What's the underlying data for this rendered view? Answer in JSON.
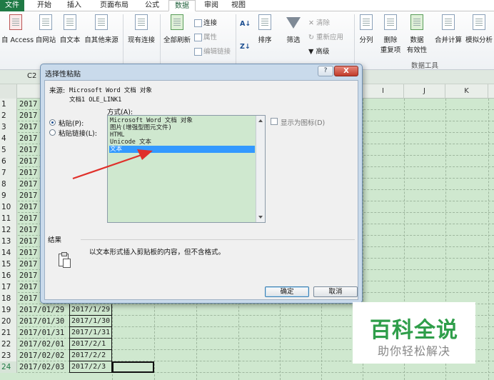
{
  "ribbon": {
    "tabs": [
      {
        "label": "文件",
        "state": "file"
      },
      {
        "label": "开始",
        "state": ""
      },
      {
        "label": "插入",
        "state": ""
      },
      {
        "label": "页面布局",
        "state": ""
      },
      {
        "label": "公式",
        "state": ""
      },
      {
        "label": "数据",
        "state": "active"
      },
      {
        "label": "审阅",
        "state": ""
      },
      {
        "label": "视图",
        "state": ""
      }
    ],
    "buttons": {
      "from_access": "自 Access",
      "from_web": "自网站",
      "from_text": "自文本",
      "from_other": "自其他来源",
      "existing_conn": "现有连接",
      "refresh_all": "全部刷新",
      "connections": "连接",
      "properties": "属性",
      "edit_links": "编辑链接",
      "sort": "排序",
      "filter": "筛选",
      "clear": "清除",
      "reapply": "重新应用",
      "advanced": "高级",
      "text_to_columns": "分列",
      "remove_dup_line1": "删除",
      "remove_dup_line2": "重复项",
      "validation_line1": "数据",
      "validation_line2": "有效性",
      "consolidate": "合并计算",
      "what_if": "模拟分析"
    },
    "groups": {
      "data_tools": "数据工具"
    }
  },
  "namebox": {
    "value": "C2"
  },
  "columns": {
    "right": [
      "I",
      "J",
      "K"
    ]
  },
  "rows": [
    {
      "n": "1",
      "a": "2017",
      "b": ""
    },
    {
      "n": "2",
      "a": "2017",
      "b": ""
    },
    {
      "n": "3",
      "a": "2017",
      "b": ""
    },
    {
      "n": "4",
      "a": "2017",
      "b": ""
    },
    {
      "n": "5",
      "a": "2017",
      "b": ""
    },
    {
      "n": "6",
      "a": "2017",
      "b": ""
    },
    {
      "n": "7",
      "a": "2017",
      "b": ""
    },
    {
      "n": "8",
      "a": "2017",
      "b": ""
    },
    {
      "n": "9",
      "a": "2017",
      "b": ""
    },
    {
      "n": "10",
      "a": "2017",
      "b": ""
    },
    {
      "n": "11",
      "a": "2017",
      "b": ""
    },
    {
      "n": "12",
      "a": "2017",
      "b": ""
    },
    {
      "n": "13",
      "a": "2017",
      "b": ""
    },
    {
      "n": "14",
      "a": "2017",
      "b": ""
    },
    {
      "n": "15",
      "a": "2017",
      "b": ""
    },
    {
      "n": "16",
      "a": "2017",
      "b": ""
    },
    {
      "n": "17",
      "a": "2017",
      "b": ""
    },
    {
      "n": "18",
      "a": "2017",
      "b": ""
    },
    {
      "n": "19",
      "a": "2017/01/29",
      "b": "2017/1/29"
    },
    {
      "n": "20",
      "a": "2017/01/30",
      "b": "2017/1/30"
    },
    {
      "n": "21",
      "a": "2017/01/31",
      "b": "2017/1/31"
    },
    {
      "n": "22",
      "a": "2017/02/01",
      "b": "2017/2/1"
    },
    {
      "n": "23",
      "a": "2017/02/02",
      "b": "2017/2/2"
    },
    {
      "n": "24",
      "a": "2017/02/03",
      "b": "2017/2/3"
    }
  ],
  "dialog": {
    "title": "选择性粘贴",
    "help": "?",
    "close": "X",
    "source_label": "来源:",
    "source_line1": "Microsoft Word 文档 对象",
    "source_line2": "文档1 OLE_LINK1",
    "format_label": "方式(A):",
    "paste_label": "粘贴(P):",
    "paste_link_label": "粘贴链接(L):",
    "formats": [
      "Microsoft Word 文档 对象",
      "图片(增强型图元文件)",
      "HTML",
      "Unicode 文本",
      "文本"
    ],
    "selected_format": 4,
    "show_as_icon": "显示为图标(D)",
    "result_label": "结果",
    "result_text": "以文本形式插入剪贴板的内容，但不含格式。",
    "ok": "确定",
    "cancel": "取消"
  },
  "watermark": {
    "title": "百科全说",
    "subtitle": "助你轻松解决"
  },
  "colors": {
    "excel_green": "#1f7a45",
    "sheet_bg": "#cfe8cf",
    "selection_blue": "#3399ff",
    "arrow_red": "#e0302a",
    "watermark_green": "#2f9e4a"
  }
}
